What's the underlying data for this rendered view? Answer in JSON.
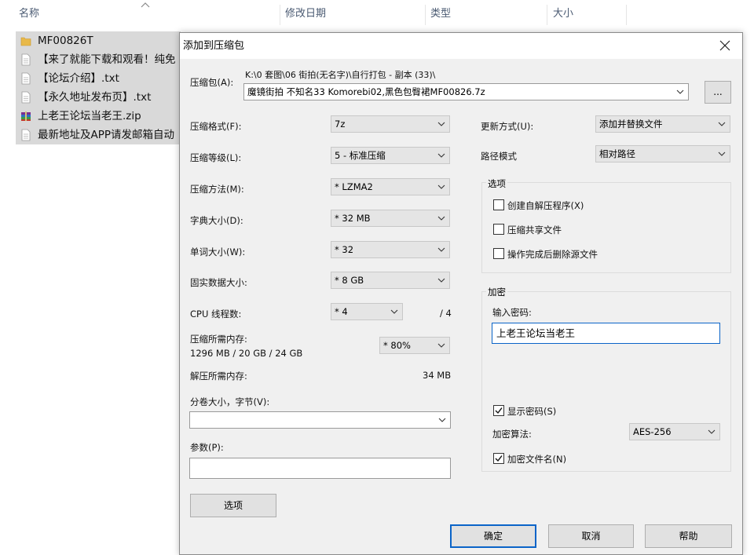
{
  "explorer": {
    "columns": [
      "名称",
      "修改日期",
      "类型",
      "大小"
    ],
    "files": [
      {
        "name": "MF00826T",
        "icon": "folder-icon"
      },
      {
        "name": "【来了就能下载和观看！纯免",
        "icon": "text-file-icon"
      },
      {
        "name": "【论坛介绍】.txt",
        "icon": "text-file-icon"
      },
      {
        "name": "【永久地址发布页】.txt",
        "icon": "text-file-icon"
      },
      {
        "name": "上老王论坛当老王.zip",
        "icon": "zip-archive-icon"
      },
      {
        "name": "最新地址及APP请发邮箱自动",
        "icon": "text-file-icon"
      }
    ]
  },
  "dialog": {
    "title": "添加到压缩包",
    "archive_label": "压缩包(A):",
    "archive_path": "K:\\0 套图\\06 街拍(无名字)\\自行打包 - 副本 (33)\\",
    "archive_name": "魔镜街拍 不知名33 Komorebi02,黑色包臀裙MF00826.7z",
    "browse_label": "...",
    "format_label": "压缩格式(F):",
    "format_value": "7z",
    "level_label": "压缩等级(L):",
    "level_value": "5 - 标准压缩",
    "method_label": "压缩方法(M):",
    "method_value": "* LZMA2",
    "dict_label": "字典大小(D):",
    "dict_value": "* 32 MB",
    "word_label": "单词大小(W):",
    "word_value": "* 32",
    "solid_label": "固实数据大小:",
    "solid_value": "* 8 GB",
    "cpu_label": "CPU 线程数:",
    "cpu_value": "* 4",
    "cpu_total": "/ 4",
    "mem_label": "压缩所需内存:",
    "mem_value": "1296 MB / 20 GB / 24 GB",
    "mem_pct": "* 80%",
    "decomp_label": "解压所需内存:",
    "decomp_value": "34 MB",
    "split_label": "分卷大小，字节(V):",
    "split_value": "",
    "params_label": "参数(P):",
    "params_value": "",
    "options_button": "选项",
    "update_label": "更新方式(U):",
    "update_value": "添加并替换文件",
    "pathmode_label": "路径模式",
    "pathmode_value": "相对路径",
    "options_group": "选项",
    "opt_sfx": "创建自解压程序(X)",
    "opt_shared": "压缩共享文件",
    "opt_delete": "操作完成后删除源文件",
    "encrypt_group": "加密",
    "password_label": "输入密码:",
    "password_value": "上老王论坛当老王",
    "show_password": "显示密码(S)",
    "enc_method_label": "加密算法:",
    "enc_method_value": "AES-256",
    "enc_names": "加密文件名(N)",
    "ok": "确定",
    "cancel": "取消",
    "help": "帮助"
  },
  "colors": {
    "dialog_bg": "#f0f0f0",
    "focus_blue": "#0a64c8",
    "selection_gray": "#d9d9d9"
  }
}
